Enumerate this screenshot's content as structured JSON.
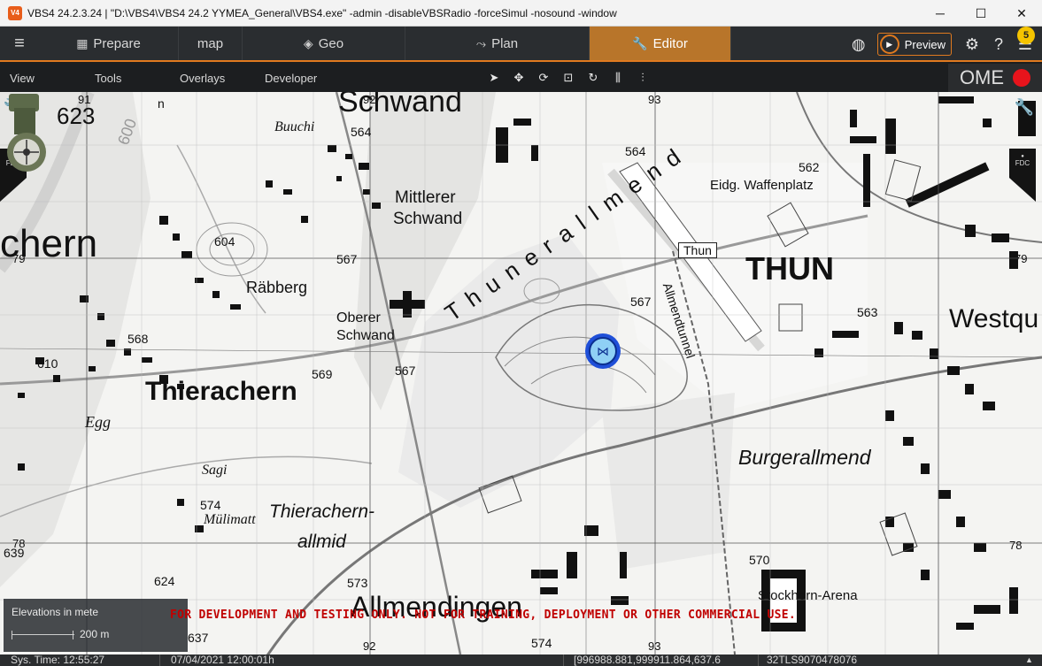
{
  "window": {
    "title": "VBS4 24.2.3.24 | \"D:\\VBS4\\VBS4 24.2 YYMEA_General\\VBS4.exe\" -admin -disableVBSRadio -forceSimul -nosound -window",
    "minimize": "─",
    "maximize": "☐",
    "close": "✕"
  },
  "nav": {
    "tabs": [
      {
        "label": "Prepare"
      },
      {
        "label": "map"
      },
      {
        "label": "Geo"
      },
      {
        "label": "Plan"
      },
      {
        "label": "Editor"
      }
    ],
    "preview_label": "Preview",
    "notification_count": "5"
  },
  "submenu": {
    "items": [
      "View",
      "Tools",
      "Overlays",
      "Developer"
    ],
    "ome_label": "OME"
  },
  "map": {
    "grid_labels": {
      "top": [
        "91",
        "92",
        "93"
      ],
      "left": [
        "79",
        "78"
      ],
      "right": [
        "79",
        "78"
      ],
      "bottom": [
        "92",
        "93"
      ]
    },
    "places": {
      "schwand": "Schwand",
      "chern": "chern",
      "n": "n",
      "buuchi": "Buuchi",
      "mittlerer_schwand_1": "Mittlerer",
      "mittlerer_schwand_2": "Schwand",
      "rabberg": "Räbberg",
      "oberer_schwand_1": "Oberer",
      "oberer_schwand_2": "Schwand",
      "thierachern": "Thierachern",
      "egg": "Egg",
      "sagi": "Sagi",
      "mulimatt": "Mülimatt",
      "thierachern_allmid_1": "Thierachern-",
      "thierachern_allmid_2": "allmid",
      "thunerallmend": "Thunerallmend",
      "eidg_waffenplatz": "Eidg. Waffenplatz",
      "thun_airfield": "Thun",
      "thun": "THUN",
      "allmendtunnel": "Allmendtunnel",
      "westqu": "Westqu",
      "burgerallmend": "Burgerallmend",
      "stockhorn_arena": "Stockhorn-Arena",
      "allmendingen": "Allmendingen"
    },
    "elevations": [
      "623",
      "564",
      "604",
      "567",
      "568",
      "610",
      "569",
      "567",
      "564",
      "562",
      "567",
      "563",
      "574",
      "573",
      "624",
      "637",
      "639",
      "570",
      "574",
      "600"
    ],
    "dev_warning": "FOR DEVELOPMENT AND TESTING ONLY. NOT FOR TRAINING, DEPLOYMENT OR OTHER COMMERCIAL USE."
  },
  "fdc_label": "FDC",
  "elevation_panel": {
    "title": "Elevations in mete",
    "scale_value": "200 m"
  },
  "statusbar": {
    "sys_time": "Sys. Time: 12:55:27",
    "date": "07/04/2021 12:00:01h",
    "coords": "[996988.881,999911.864,637.6",
    "mgrs": "32TLS9070478076"
  },
  "colors": {
    "accent": "#e07a1f",
    "editor_tab": "#b8752a",
    "record": "#e8141c",
    "warning_text": "#c00000",
    "marker_fill": "#8fd0f5",
    "marker_ring": "#1f4fd8"
  }
}
